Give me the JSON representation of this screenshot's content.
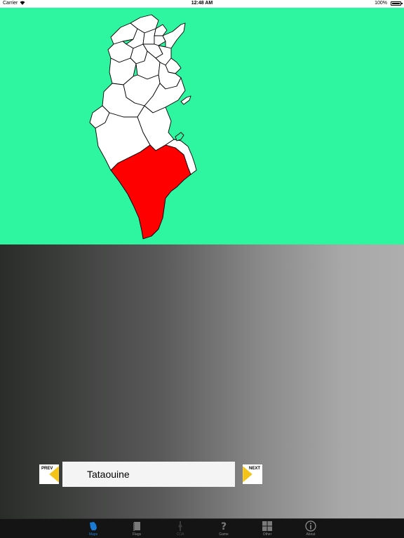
{
  "status_bar": {
    "carrier": "Carrier",
    "wifi_icon": "wifi-icon",
    "time": "12:48 AM",
    "battery": "100%",
    "battery_icon": "battery-full-icon"
  },
  "map": {
    "background_color": "#2ef6a0",
    "region_fill": "#ffffff",
    "selected_fill": "#ff0000",
    "selected_region": "Tataouine"
  },
  "navigation": {
    "prev_label": "PREV",
    "next_label": "NEXT",
    "current_region": "Tataouine",
    "arrow_color": "#f2c418"
  },
  "tab_bar": {
    "active_color": "#1a7bd6",
    "tabs": [
      {
        "label": "Maps",
        "icon": "map-icon",
        "state": "active"
      },
      {
        "label": "Flags",
        "icon": "flag-book-icon",
        "state": "normal"
      },
      {
        "label": "COA",
        "icon": "coat-of-arms-icon",
        "state": "disabled"
      },
      {
        "label": "Game",
        "icon": "question-mark-icon",
        "state": "normal"
      },
      {
        "label": "Other",
        "icon": "grid-icon",
        "state": "normal"
      },
      {
        "label": "About",
        "icon": "info-icon",
        "state": "normal"
      }
    ]
  }
}
